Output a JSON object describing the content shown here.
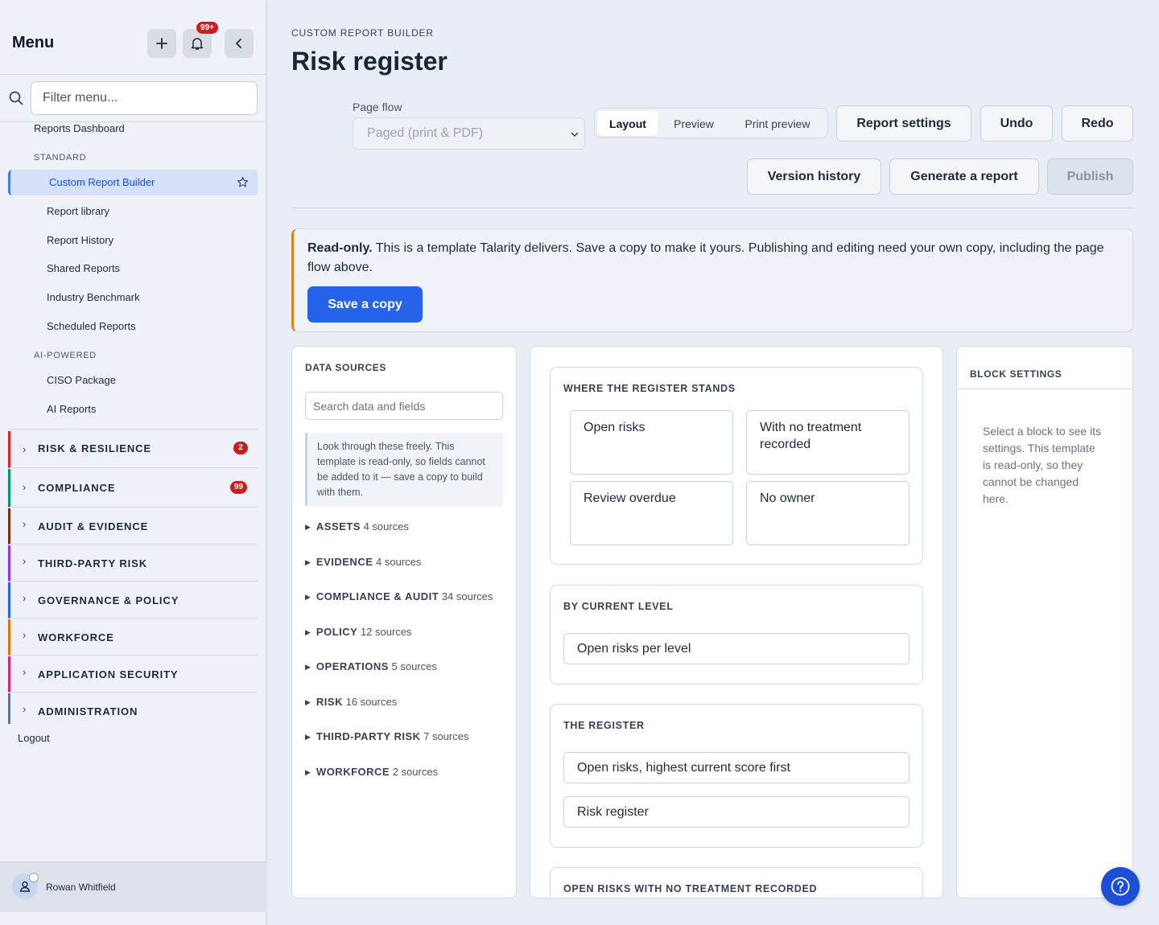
{
  "sidebar": {
    "title": "Menu",
    "notification_badge": "99+",
    "filter_placeholder": "Filter menu...",
    "top_link": "Reports Dashboard",
    "standard_label": "STANDARD",
    "standard_items": [
      "Custom Report Builder",
      "Report library",
      "Report History",
      "Shared Reports",
      "Industry Benchmark",
      "Scheduled Reports"
    ],
    "ai_label": "AI-POWERED",
    "ai_items": [
      "CISO Package",
      "AI Reports"
    ],
    "categories": [
      {
        "label": "RISK & RESILIENCE",
        "badge": "2",
        "color": "#dc2626"
      },
      {
        "label": "COMPLIANCE",
        "badge": "99",
        "color": "#059669"
      },
      {
        "label": "AUDIT & EVIDENCE",
        "badge": "",
        "color": "#7c2d12"
      },
      {
        "label": "THIRD-PARTY RISK",
        "badge": "",
        "color": "#9333ea"
      },
      {
        "label": "GOVERNANCE & POLICY",
        "badge": "",
        "color": "#2563eb"
      },
      {
        "label": "WORKFORCE",
        "badge": "",
        "color": "#d97706"
      },
      {
        "label": "APPLICATION SECURITY",
        "badge": "",
        "color": "#db2777"
      },
      {
        "label": "ADMINISTRATION",
        "badge": "",
        "color": "#64748b"
      }
    ],
    "logout": "Logout",
    "user_name": "Rowan Whitfield"
  },
  "header": {
    "breadcrumb": "CUSTOM REPORT BUILDER",
    "title": "Risk register",
    "page_flow_label": "Page flow",
    "page_flow_value": "Paged (print & PDF)",
    "tabs": [
      "Layout",
      "Preview",
      "Print preview"
    ],
    "buttons": {
      "report_settings": "Report settings",
      "undo": "Undo",
      "redo": "Redo",
      "version_history": "Version history",
      "generate": "Generate a report",
      "publish": "Publish"
    }
  },
  "notice": {
    "bold": "Read-only.",
    "text": " This is a template Talarity delivers. Save a copy to make it yours. Publishing and editing need your own copy, including the page flow above.",
    "button": "Save a copy"
  },
  "data_sources": {
    "title": "DATA SOURCES",
    "search_placeholder": "Search data and fields",
    "note": "Look through these freely. This template is read-only, so fields cannot be added to it — save a copy to build with them.",
    "items": [
      {
        "name": "ASSETS",
        "count": "4 sources"
      },
      {
        "name": "EVIDENCE",
        "count": "4 sources"
      },
      {
        "name": "COMPLIANCE & AUDIT",
        "count": "34 sources"
      },
      {
        "name": "POLICY",
        "count": "12 sources"
      },
      {
        "name": "OPERATIONS",
        "count": "5 sources"
      },
      {
        "name": "RISK",
        "count": "16 sources"
      },
      {
        "name": "THIRD-PARTY RISK",
        "count": "7 sources"
      },
      {
        "name": "WORKFORCE",
        "count": "2 sources"
      }
    ]
  },
  "canvas": {
    "sections": [
      {
        "title": "WHERE THE REGISTER STANDS",
        "blocks": [
          "Open risks",
          "With no treatment recorded",
          "Review overdue",
          "No owner"
        ]
      },
      {
        "title": "BY CURRENT LEVEL",
        "blocks": [
          "Open risks per level"
        ]
      },
      {
        "title": "THE REGISTER",
        "blocks": [
          "Open risks, highest current score first",
          "Risk register"
        ]
      },
      {
        "title": "OPEN RISKS WITH NO TREATMENT RECORDED",
        "blocks": []
      }
    ]
  },
  "block_settings": {
    "title": "BLOCK SETTINGS",
    "text": "Select a block to see its settings. This template is read-only, so they cannot be changed here."
  }
}
